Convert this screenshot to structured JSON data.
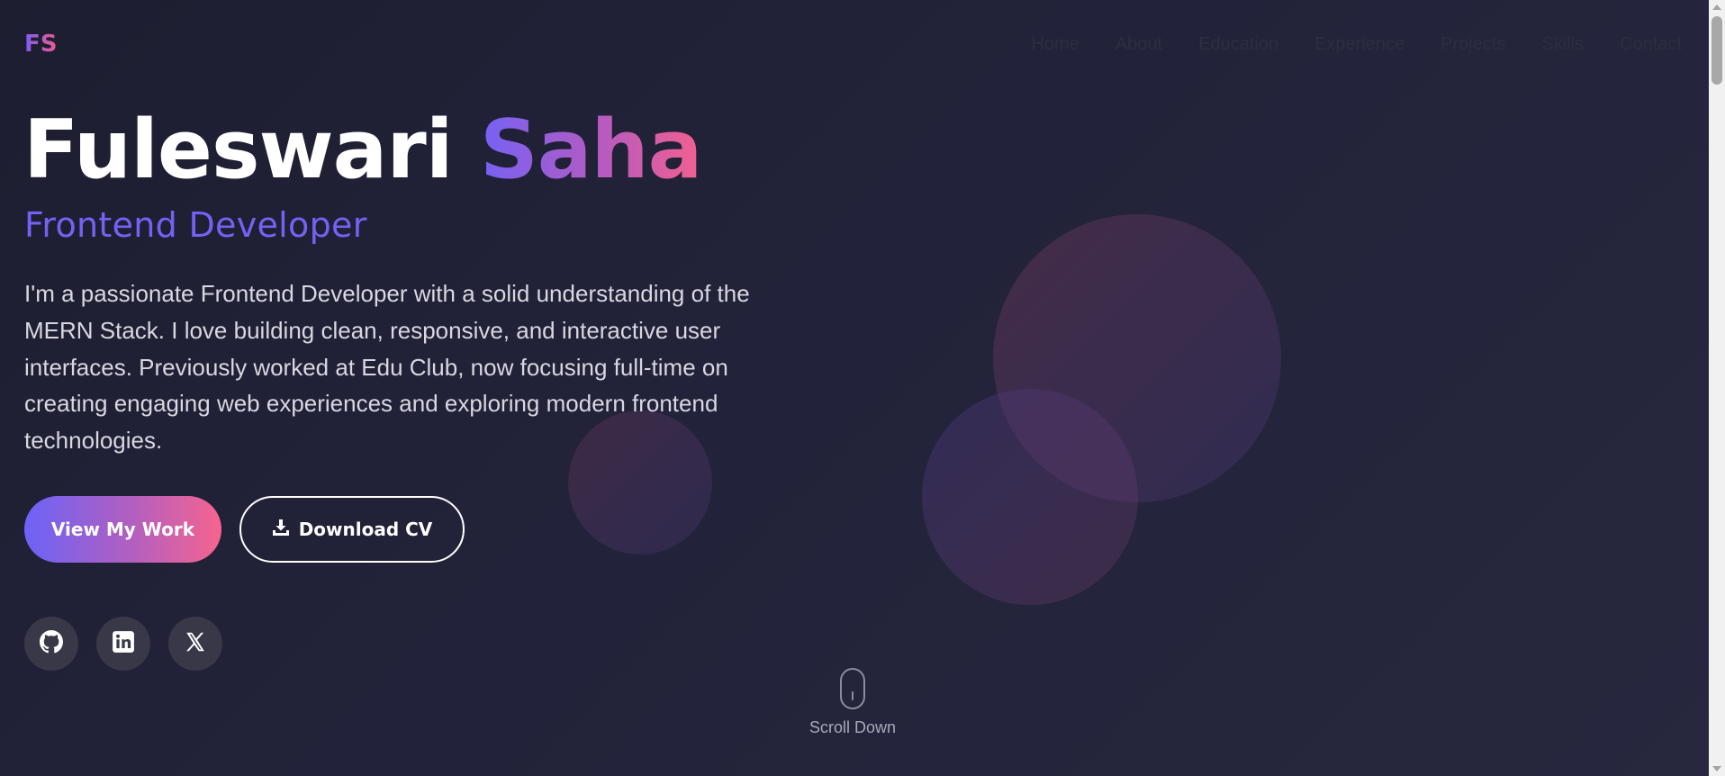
{
  "brand": {
    "logo": "FS",
    "gradient_start": "#7c5cf6",
    "gradient_end": "#f25a8c"
  },
  "nav": {
    "items": [
      {
        "label": "Home"
      },
      {
        "label": "About"
      },
      {
        "label": "Education"
      },
      {
        "label": "Experience"
      },
      {
        "label": "Projects"
      },
      {
        "label": "Skills"
      },
      {
        "label": "Contact"
      }
    ]
  },
  "hero": {
    "first_name": "Fuleswari",
    "last_name": "Saha",
    "role": "Frontend Developer",
    "bio": "I'm a passionate Frontend Developer with a solid understanding of the MERN Stack. I love building clean, responsive, and interactive user interfaces. Previously worked at Edu Club, now focusing full-time on creating engaging web experiences and exploring modern frontend technologies."
  },
  "actions": {
    "primary_label": "View My Work",
    "secondary_label": "Download CV",
    "secondary_icon": "download-icon"
  },
  "social": [
    {
      "icon": "github-icon"
    },
    {
      "icon": "linkedin-icon"
    },
    {
      "icon": "x-twitter-icon"
    }
  ],
  "scroll": {
    "label": "Scroll Down",
    "icon": "mouse-icon"
  },
  "colors": {
    "background": "#1f1f33",
    "accent": "#7462f4",
    "accent_pink": "#f2608f",
    "text": "#d8d8e2"
  }
}
